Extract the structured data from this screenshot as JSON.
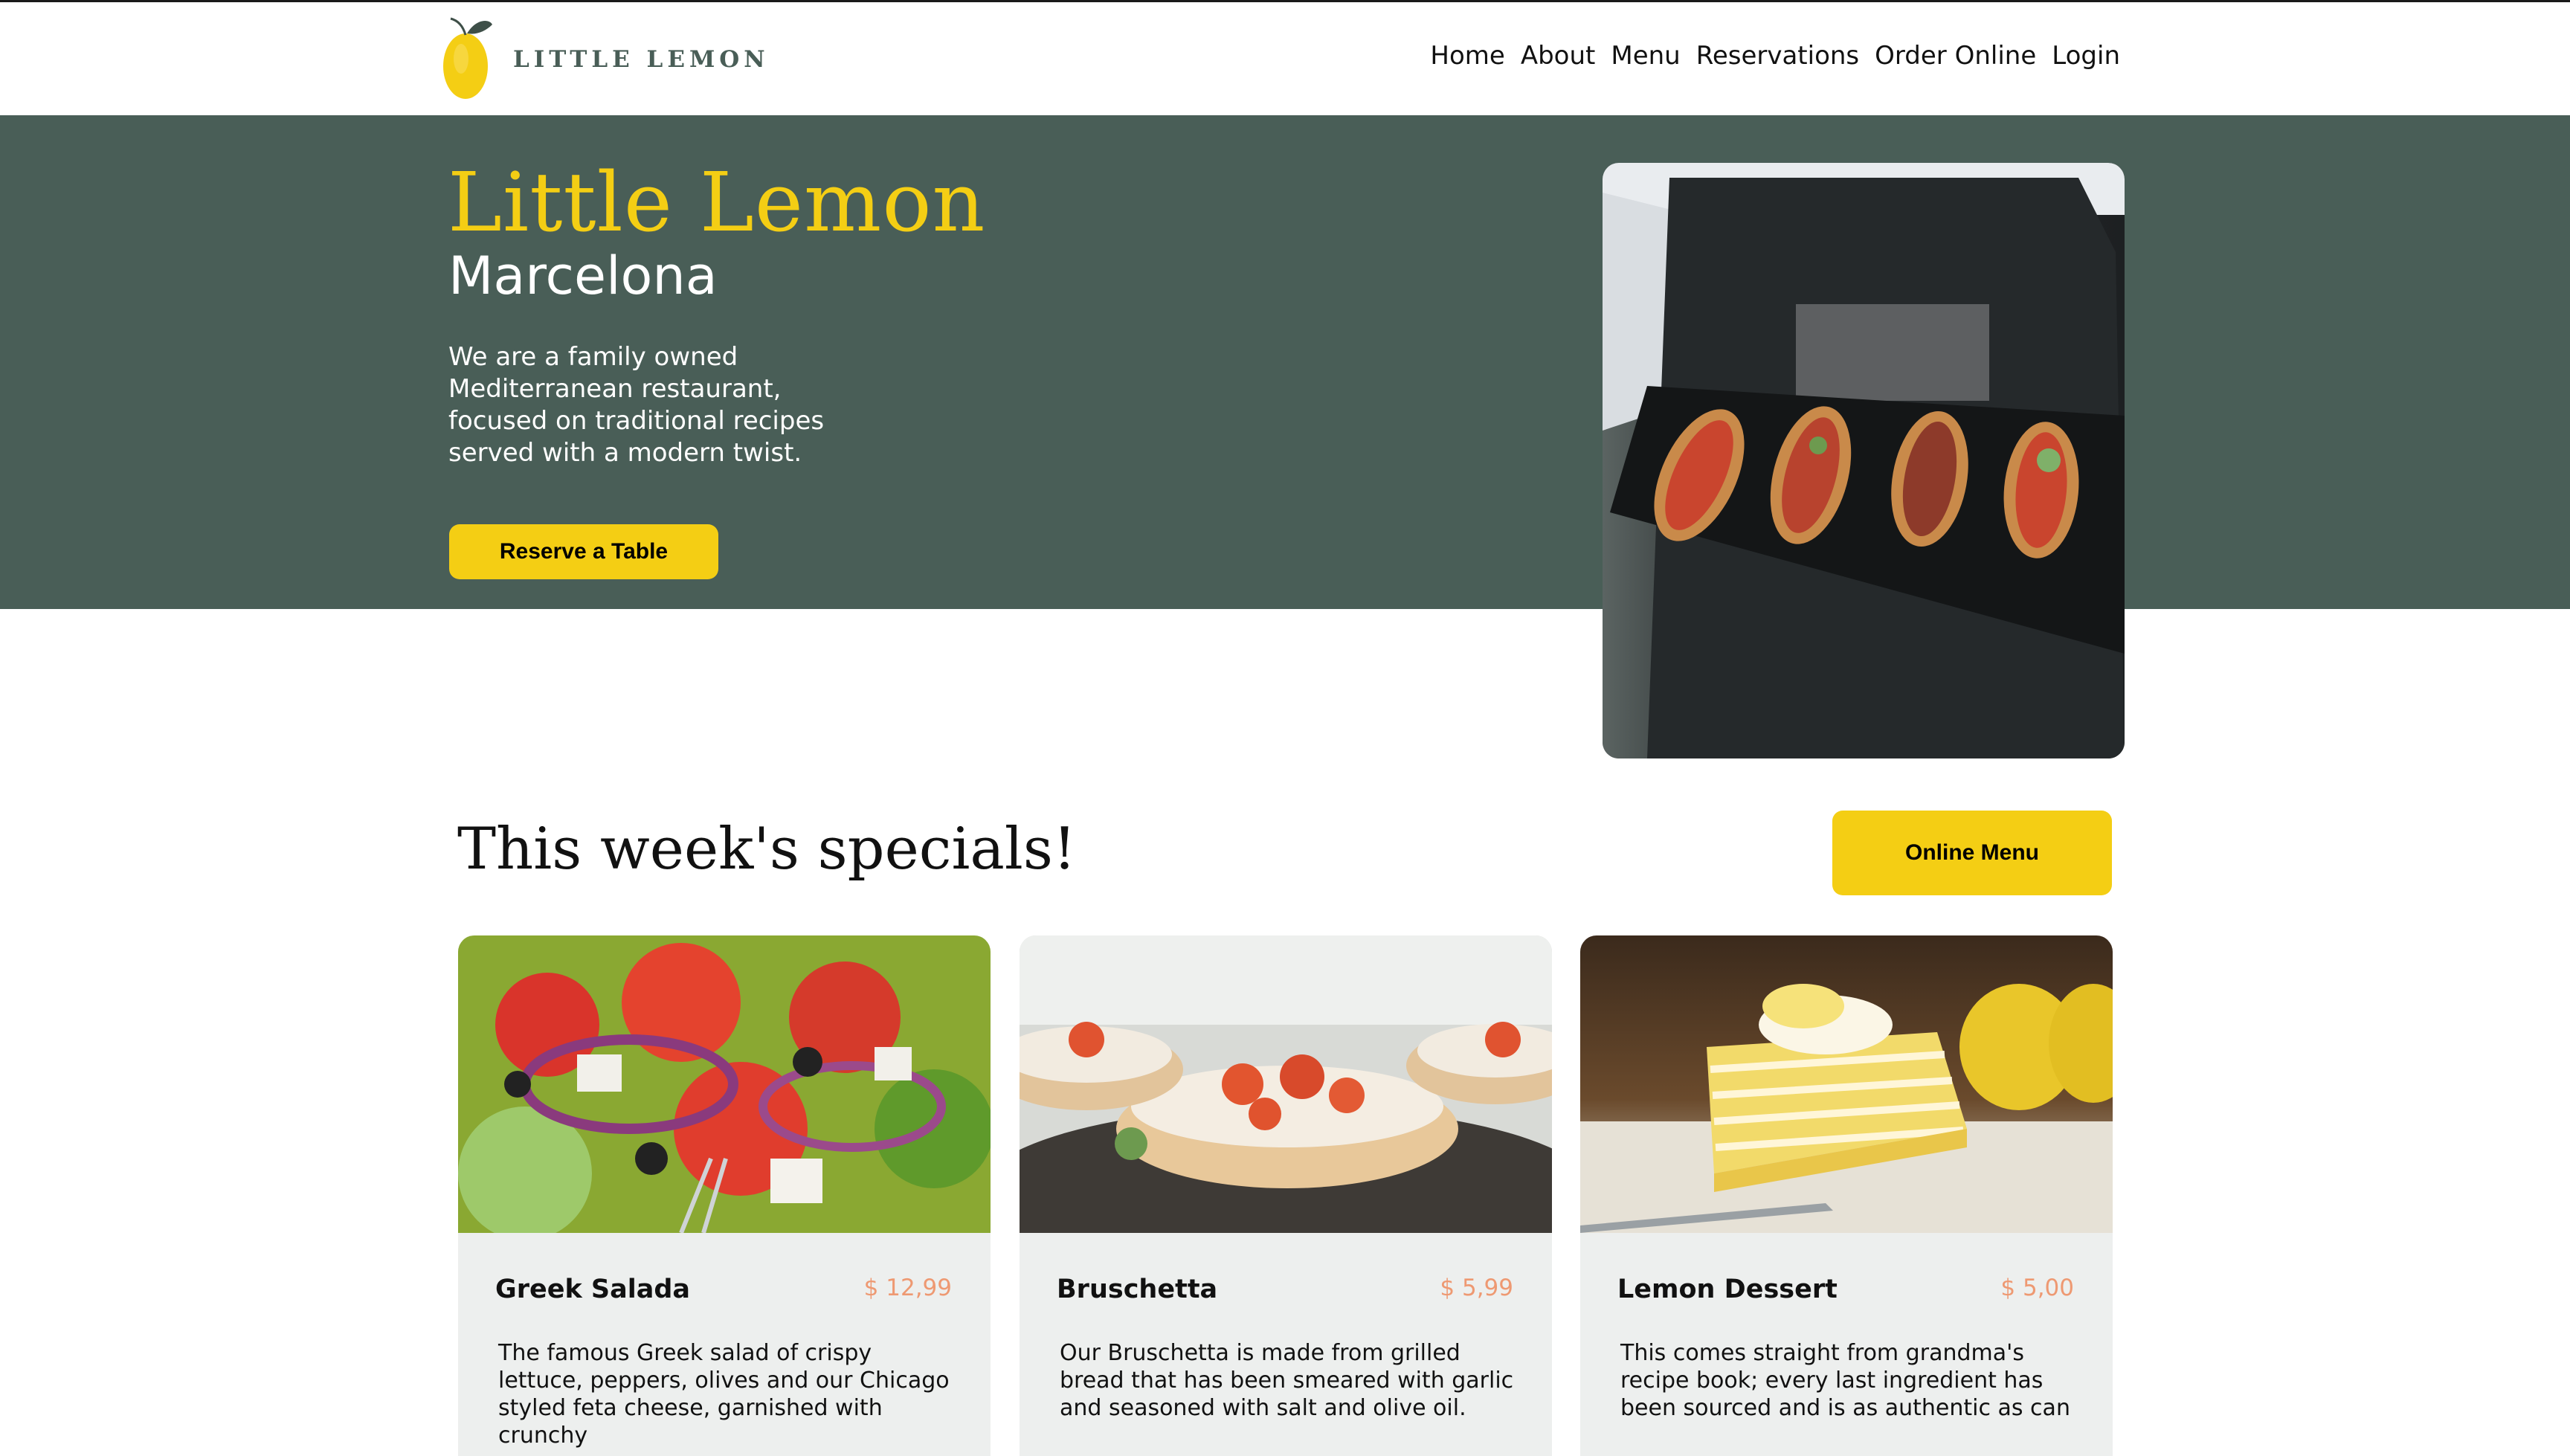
{
  "brand": {
    "logo_text": "LITTLE LEMON",
    "colors": {
      "primary": "#495e57",
      "accent": "#f4ce14",
      "price": "#ee9972",
      "card_bg": "#edefee"
    }
  },
  "nav": {
    "items": [
      "Home",
      "About",
      "Menu",
      "Reservations",
      "Order Online",
      "Login"
    ]
  },
  "hero": {
    "title": "Little Lemon",
    "subtitle": "Marcelona",
    "description": "We are a family owned Mediterranean restaurant, focused on traditional recipes served with a modern twist.",
    "cta_label": "Reserve a Table"
  },
  "specials": {
    "title": "This week's specials!",
    "menu_button_label": "Online Menu",
    "cards": [
      {
        "name": "Greek Salada",
        "price": "$ 12,99",
        "description": "The famous Greek salad of crispy lettuce, peppers, olives and our Chicago styled feta cheese, garnished with crunchy"
      },
      {
        "name": "Bruschetta",
        "price": "$ 5,99",
        "description": "Our Bruschetta is made from grilled bread that has been smeared with garlic and seasoned with salt and olive oil."
      },
      {
        "name": "Lemon Dessert",
        "price": "$ 5,00",
        "description": "This comes straight from grandma's recipe book; every last ingredient has been sourced and is as authentic as can"
      }
    ]
  }
}
